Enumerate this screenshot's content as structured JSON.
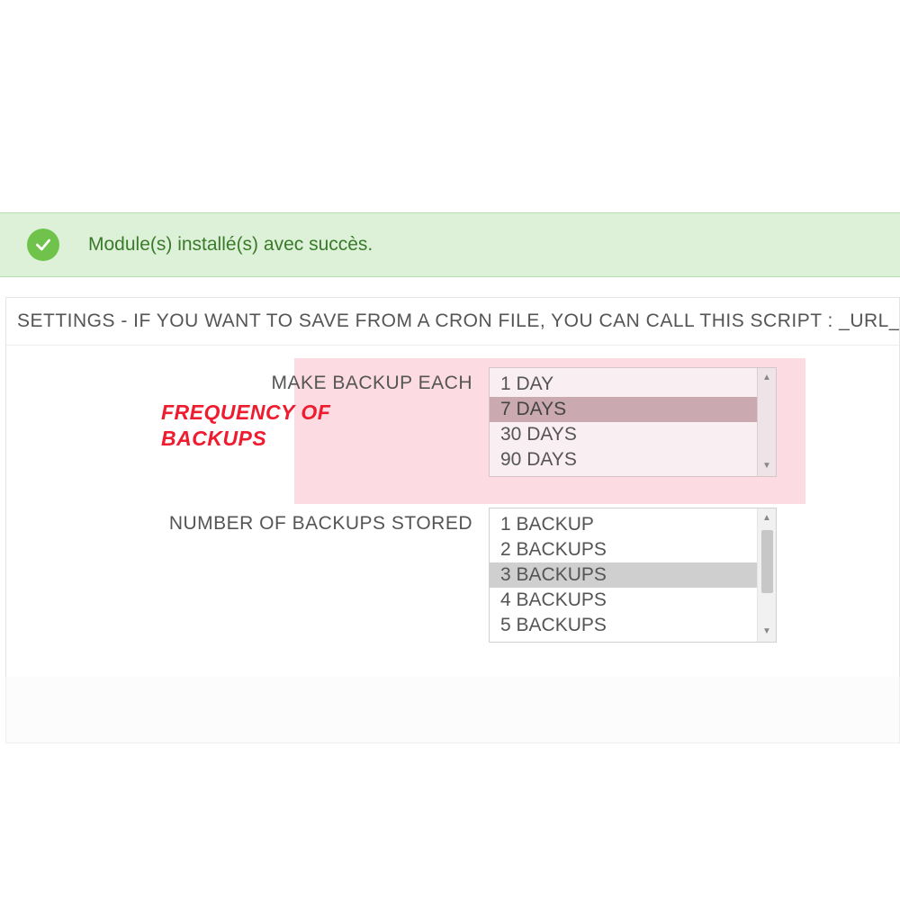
{
  "alert": {
    "message": "Module(s) installé(s) avec succès."
  },
  "panel": {
    "header": "SETTINGS - IF YOU WANT TO SAVE FROM A CRON FILE, YOU CAN CALL THIS SCRIPT : _URL_WEBSITE_/MODULES/DATABASEA"
  },
  "form": {
    "frequency_label": "MAKE BACKUP EACH",
    "stored_label": "NUMBER OF BACKUPS STORED"
  },
  "frequency_options": {
    "o0": "1 DAY",
    "o1": "7 DAYS",
    "o2": "30 DAYS",
    "o3": "90 DAYS"
  },
  "stored_options": {
    "o0": "1 BACKUP",
    "o1": "2 BACKUPS",
    "o2": "3 BACKUPS",
    "o3": "4 BACKUPS",
    "o4": "5 BACKUPS"
  },
  "annotation": {
    "line1": "FREQUENCY OF",
    "line2": "BACKUPS"
  }
}
